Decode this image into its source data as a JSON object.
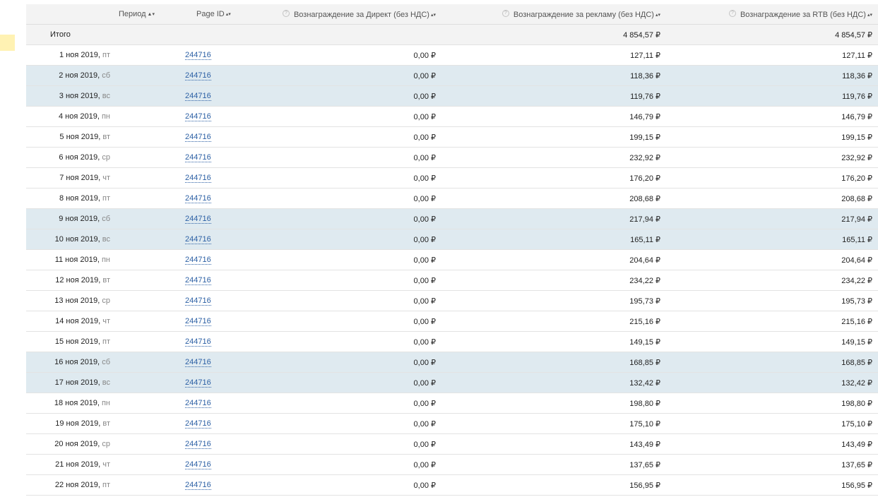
{
  "headers": {
    "period": "Период",
    "page_id": "Page ID",
    "direct": "Вознаграждение за Директ (без НДС)",
    "ads": "Вознаграждение за рекламу (без НДС)",
    "rtb": "Вознаграждение за RTB (без НДС)"
  },
  "icons": {
    "sort_active": "▲▾",
    "sort": "▴▾",
    "help": "?"
  },
  "total": {
    "label": "Итого",
    "direct": "",
    "ads": "4 854,57 ₽",
    "rtb": "4 854,57 ₽"
  },
  "rows": [
    {
      "date": "1 ноя 2019,",
      "dow": "пт",
      "page_id": "244716",
      "direct": "0,00 ₽",
      "ads": "127,11 ₽",
      "rtb": "127,11 ₽",
      "weekend": false
    },
    {
      "date": "2 ноя 2019,",
      "dow": "сб",
      "page_id": "244716",
      "direct": "0,00 ₽",
      "ads": "118,36 ₽",
      "rtb": "118,36 ₽",
      "weekend": true
    },
    {
      "date": "3 ноя 2019,",
      "dow": "вс",
      "page_id": "244716",
      "direct": "0,00 ₽",
      "ads": "119,76 ₽",
      "rtb": "119,76 ₽",
      "weekend": true
    },
    {
      "date": "4 ноя 2019,",
      "dow": "пн",
      "page_id": "244716",
      "direct": "0,00 ₽",
      "ads": "146,79 ₽",
      "rtb": "146,79 ₽",
      "weekend": false
    },
    {
      "date": "5 ноя 2019,",
      "dow": "вт",
      "page_id": "244716",
      "direct": "0,00 ₽",
      "ads": "199,15 ₽",
      "rtb": "199,15 ₽",
      "weekend": false
    },
    {
      "date": "6 ноя 2019,",
      "dow": "ср",
      "page_id": "244716",
      "direct": "0,00 ₽",
      "ads": "232,92 ₽",
      "rtb": "232,92 ₽",
      "weekend": false
    },
    {
      "date": "7 ноя 2019,",
      "dow": "чт",
      "page_id": "244716",
      "direct": "0,00 ₽",
      "ads": "176,20 ₽",
      "rtb": "176,20 ₽",
      "weekend": false
    },
    {
      "date": "8 ноя 2019,",
      "dow": "пт",
      "page_id": "244716",
      "direct": "0,00 ₽",
      "ads": "208,68 ₽",
      "rtb": "208,68 ₽",
      "weekend": false
    },
    {
      "date": "9 ноя 2019,",
      "dow": "сб",
      "page_id": "244716",
      "direct": "0,00 ₽",
      "ads": "217,94 ₽",
      "rtb": "217,94 ₽",
      "weekend": true
    },
    {
      "date": "10 ноя 2019,",
      "dow": "вс",
      "page_id": "244716",
      "direct": "0,00 ₽",
      "ads": "165,11 ₽",
      "rtb": "165,11 ₽",
      "weekend": true
    },
    {
      "date": "11 ноя 2019,",
      "dow": "пн",
      "page_id": "244716",
      "direct": "0,00 ₽",
      "ads": "204,64 ₽",
      "rtb": "204,64 ₽",
      "weekend": false
    },
    {
      "date": "12 ноя 2019,",
      "dow": "вт",
      "page_id": "244716",
      "direct": "0,00 ₽",
      "ads": "234,22 ₽",
      "rtb": "234,22 ₽",
      "weekend": false
    },
    {
      "date": "13 ноя 2019,",
      "dow": "ср",
      "page_id": "244716",
      "direct": "0,00 ₽",
      "ads": "195,73 ₽",
      "rtb": "195,73 ₽",
      "weekend": false
    },
    {
      "date": "14 ноя 2019,",
      "dow": "чт",
      "page_id": "244716",
      "direct": "0,00 ₽",
      "ads": "215,16 ₽",
      "rtb": "215,16 ₽",
      "weekend": false
    },
    {
      "date": "15 ноя 2019,",
      "dow": "пт",
      "page_id": "244716",
      "direct": "0,00 ₽",
      "ads": "149,15 ₽",
      "rtb": "149,15 ₽",
      "weekend": false
    },
    {
      "date": "16 ноя 2019,",
      "dow": "сб",
      "page_id": "244716",
      "direct": "0,00 ₽",
      "ads": "168,85 ₽",
      "rtb": "168,85 ₽",
      "weekend": true
    },
    {
      "date": "17 ноя 2019,",
      "dow": "вс",
      "page_id": "244716",
      "direct": "0,00 ₽",
      "ads": "132,42 ₽",
      "rtb": "132,42 ₽",
      "weekend": true
    },
    {
      "date": "18 ноя 2019,",
      "dow": "пн",
      "page_id": "244716",
      "direct": "0,00 ₽",
      "ads": "198,80 ₽",
      "rtb": "198,80 ₽",
      "weekend": false
    },
    {
      "date": "19 ноя 2019,",
      "dow": "вт",
      "page_id": "244716",
      "direct": "0,00 ₽",
      "ads": "175,10 ₽",
      "rtb": "175,10 ₽",
      "weekend": false
    },
    {
      "date": "20 ноя 2019,",
      "dow": "ср",
      "page_id": "244716",
      "direct": "0,00 ₽",
      "ads": "143,49 ₽",
      "rtb": "143,49 ₽",
      "weekend": false
    },
    {
      "date": "21 ноя 2019,",
      "dow": "чт",
      "page_id": "244716",
      "direct": "0,00 ₽",
      "ads": "137,65 ₽",
      "rtb": "137,65 ₽",
      "weekend": false
    },
    {
      "date": "22 ноя 2019,",
      "dow": "пт",
      "page_id": "244716",
      "direct": "0,00 ₽",
      "ads": "156,95 ₽",
      "rtb": "156,95 ₽",
      "weekend": false
    }
  ],
  "colors": {
    "weekend_row": "#dfeaf0",
    "header_bg": "#f3f3f3",
    "link": "#2b5fa4",
    "side_tab": "#fff2b3"
  }
}
